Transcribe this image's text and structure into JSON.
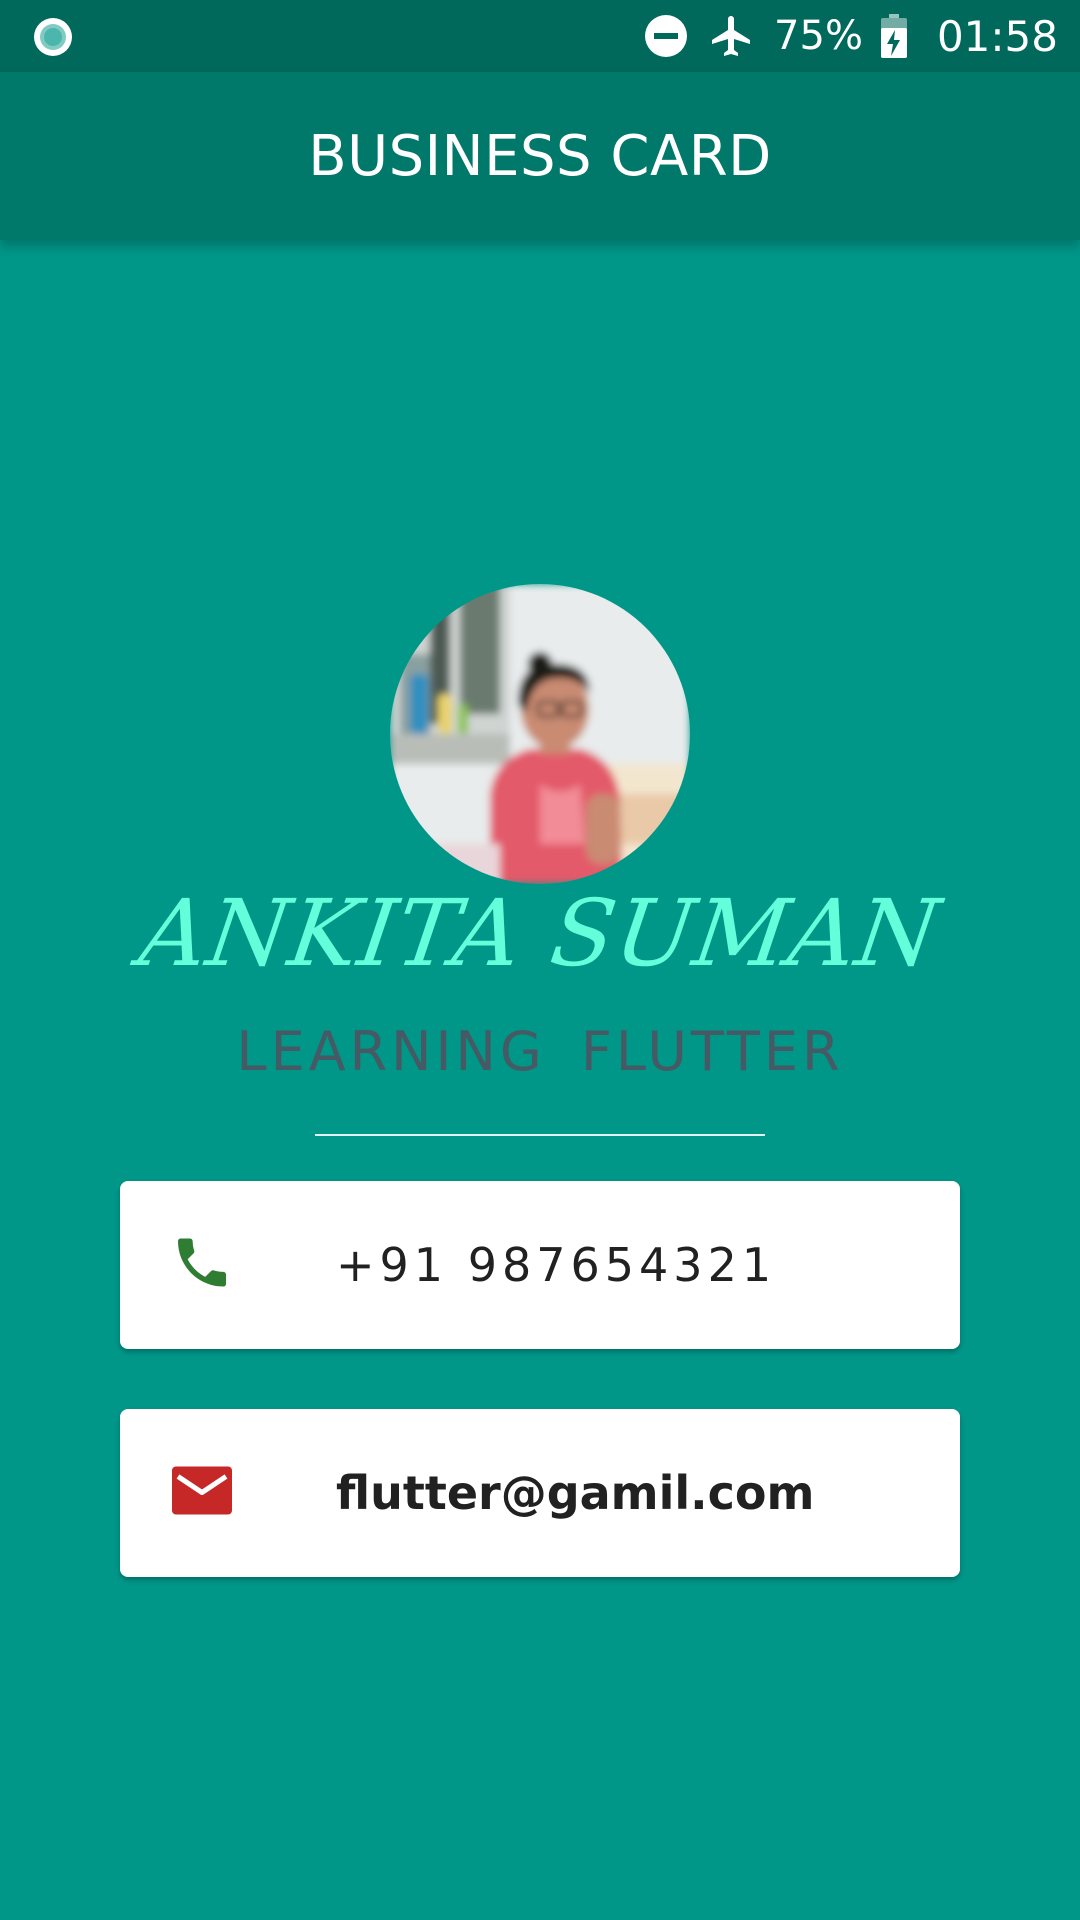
{
  "status_bar": {
    "battery_percent": "75%",
    "time": "01:58",
    "icons": [
      "record-icon",
      "do-not-disturb-icon",
      "airplane-icon",
      "battery-charging-icon"
    ]
  },
  "app_bar": {
    "title": "BUSINESS CARD"
  },
  "profile": {
    "name": "ANKITA SUMAN",
    "subtitle": "LEARNING  FLUTTER"
  },
  "contact": {
    "phone": "+91 987654321",
    "email": "flutter@gamil.com"
  },
  "colors": {
    "background": "#009688",
    "app_bar": "#00796b",
    "status_bar": "#00695c",
    "name": "#64ffda",
    "subtitle": "#455a64",
    "phone_icon": "#2e7d32",
    "email_icon": "#c62828"
  }
}
